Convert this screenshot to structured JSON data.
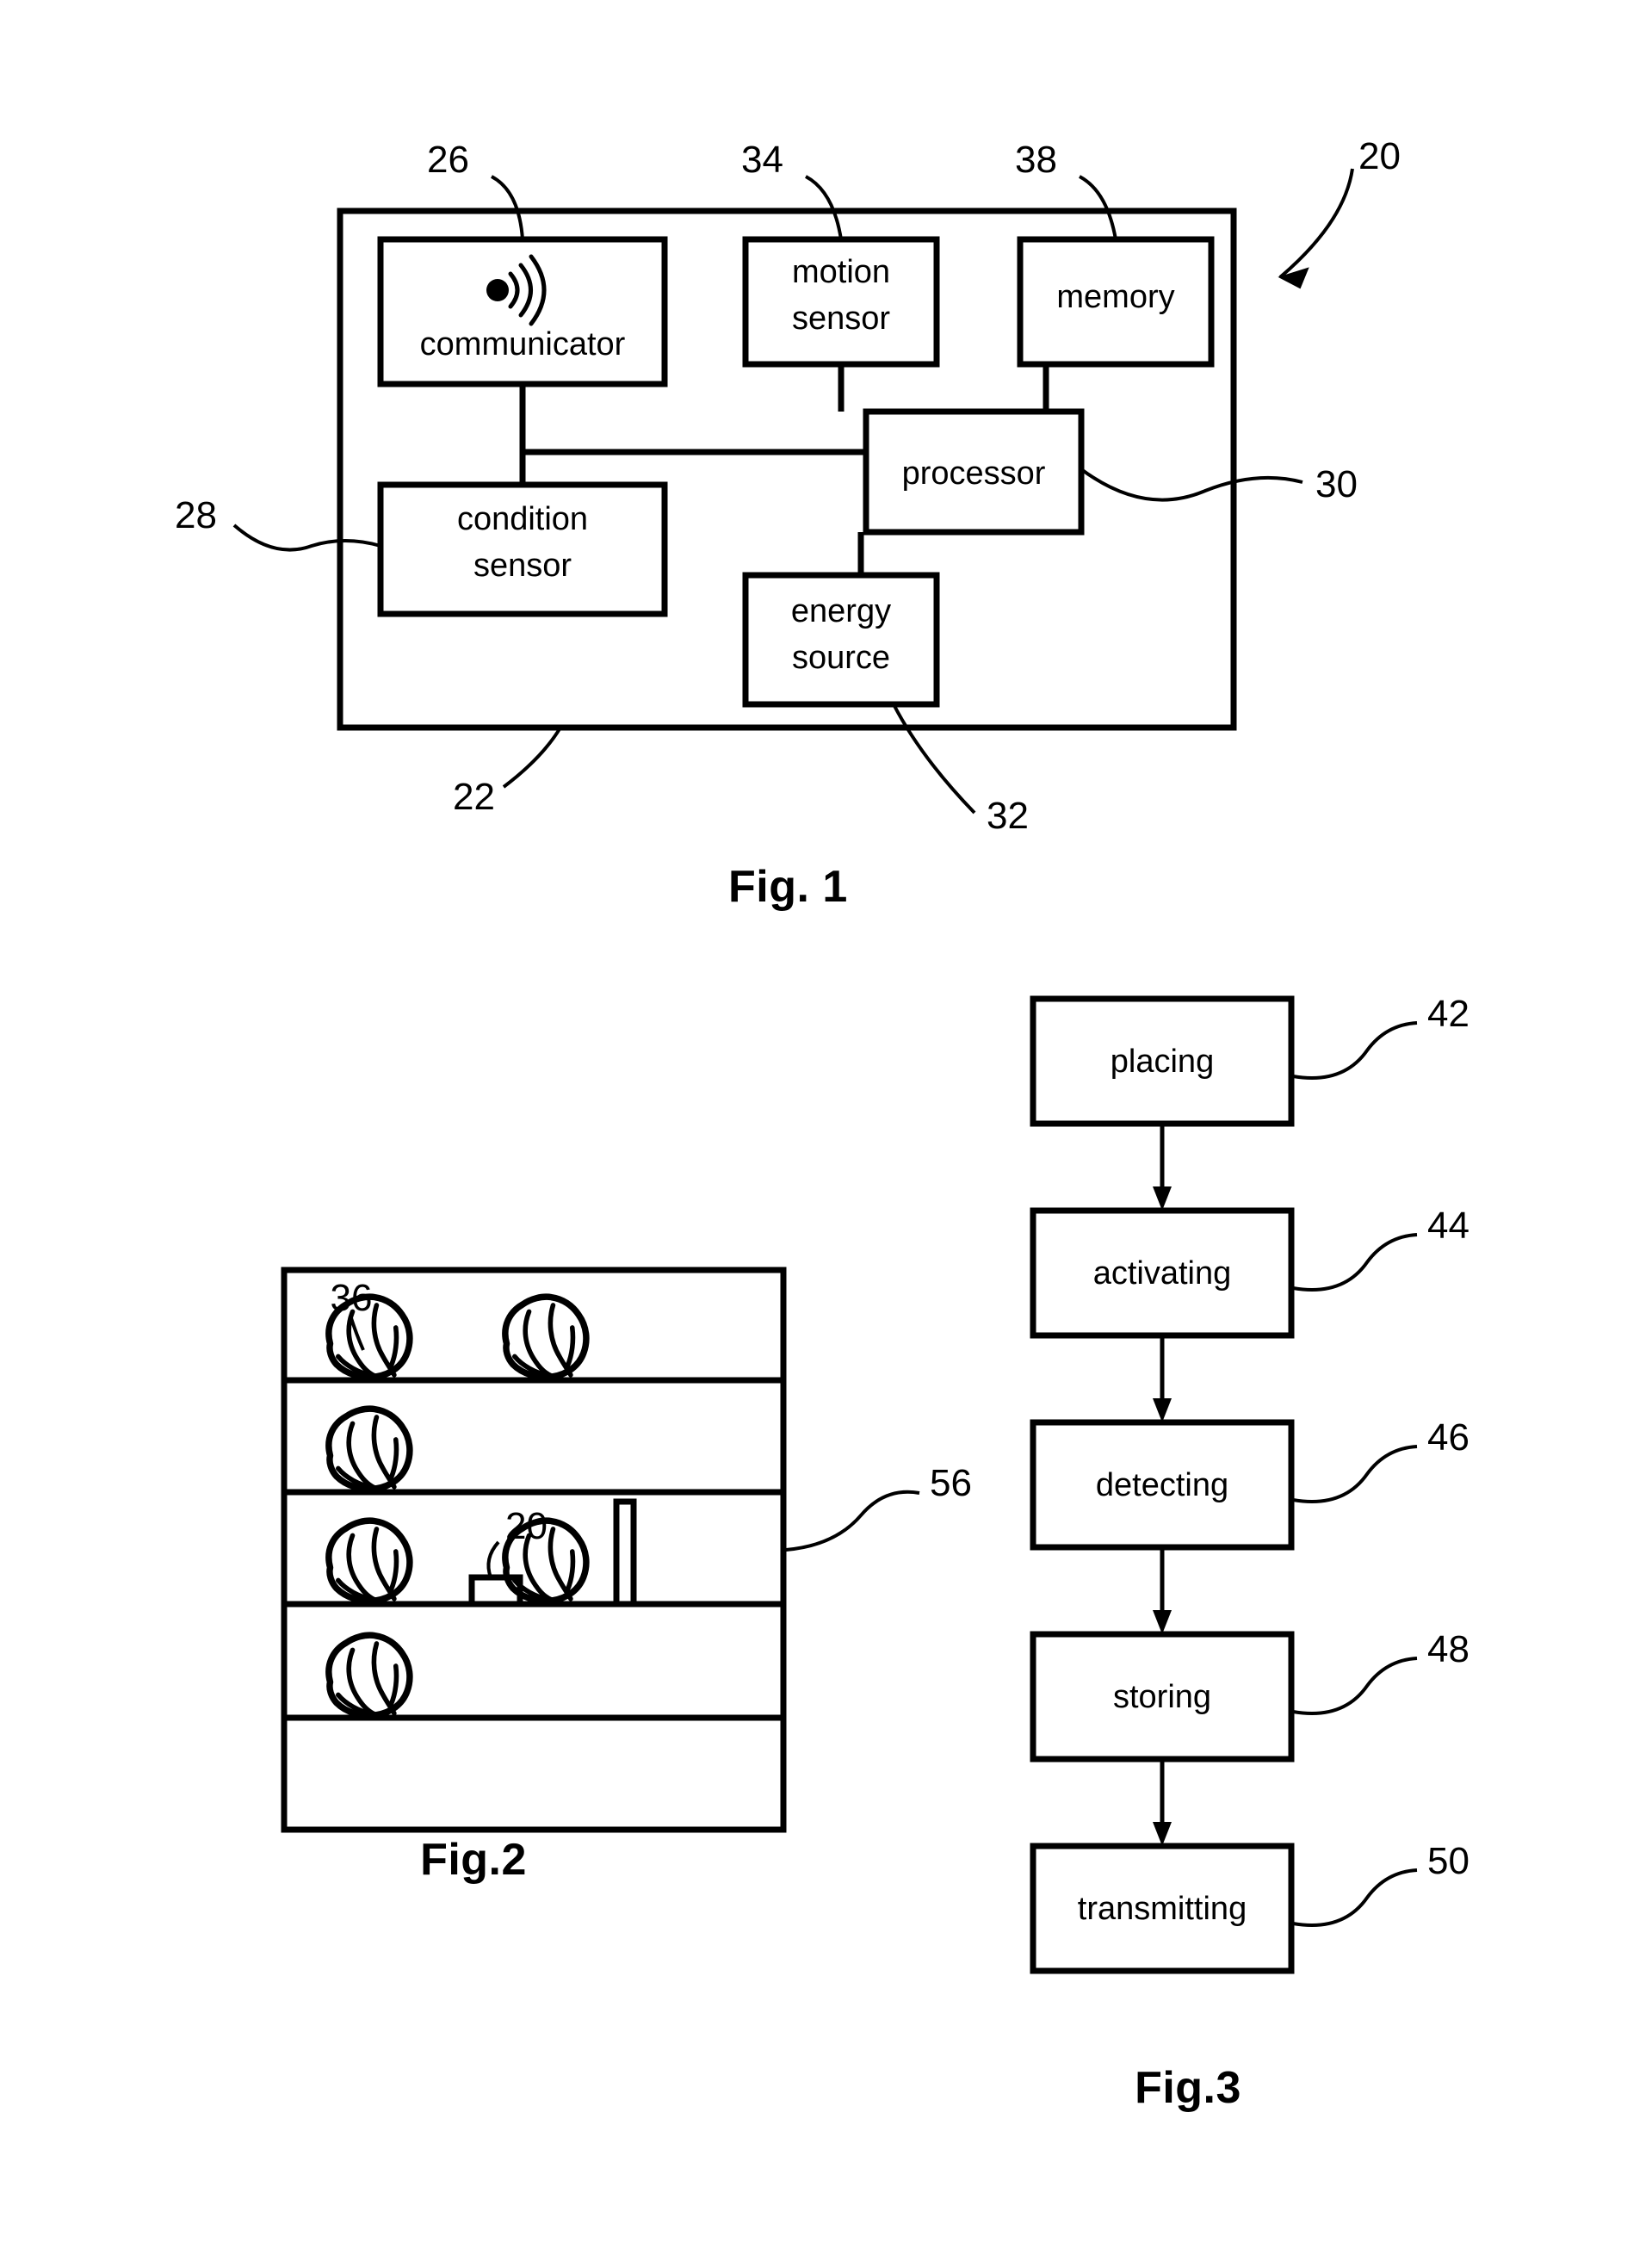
{
  "document": {
    "type": "patent-drawing-sheet",
    "figures": [
      "Fig. 1",
      "Fig.2",
      "Fig.3"
    ]
  },
  "fig1": {
    "caption": "Fig. 1",
    "enclosure_ref": "22",
    "assembly_ref": "20",
    "blocks": [
      {
        "id": "communicator",
        "label": "communicator",
        "ref": "26",
        "icon": "wireless-signal-icon"
      },
      {
        "id": "motion_sensor",
        "label_line1": "motion",
        "label_line2": "sensor",
        "ref": "34"
      },
      {
        "id": "memory",
        "label": "memory",
        "ref": "38"
      },
      {
        "id": "condition_sensor",
        "label_line1": "condition",
        "label_line2": "sensor",
        "ref": "28"
      },
      {
        "id": "processor",
        "label": "processor",
        "ref": "30"
      },
      {
        "id": "energy_source",
        "label_line1": "energy",
        "label_line2": "source",
        "ref": "32"
      }
    ],
    "refs": {
      "communicator": "26",
      "motion_sensor": "34",
      "memory": "38",
      "assembly": "20",
      "condition_sensor": "28",
      "processor": "30",
      "housing": "22",
      "energy_source": "32"
    }
  },
  "fig2": {
    "caption": "Fig.2",
    "refs": {
      "produce_item": "36",
      "sensor_device": "20",
      "shelving_unit": "56"
    },
    "shelf_count": 5,
    "produce_positions": [
      {
        "shelf": 2,
        "slot": "left"
      },
      {
        "shelf": 2,
        "slot": "right"
      },
      {
        "shelf": 3,
        "slot": "left"
      },
      {
        "shelf": 4,
        "slot": "left"
      },
      {
        "shelf": 4,
        "slot": "right"
      },
      {
        "shelf": 5,
        "slot": "left"
      }
    ],
    "device_on_shelf": 3,
    "strip_on_shelf": 3
  },
  "fig3": {
    "caption": "Fig.3",
    "steps": [
      {
        "label": "placing",
        "ref": "42"
      },
      {
        "label": "activating",
        "ref": "44"
      },
      {
        "label": "detecting",
        "ref": "46"
      },
      {
        "label": "storing",
        "ref": "48"
      },
      {
        "label": "transmitting",
        "ref": "50"
      }
    ]
  },
  "colors": {
    "ink": "#000000",
    "paper": "#ffffff"
  }
}
